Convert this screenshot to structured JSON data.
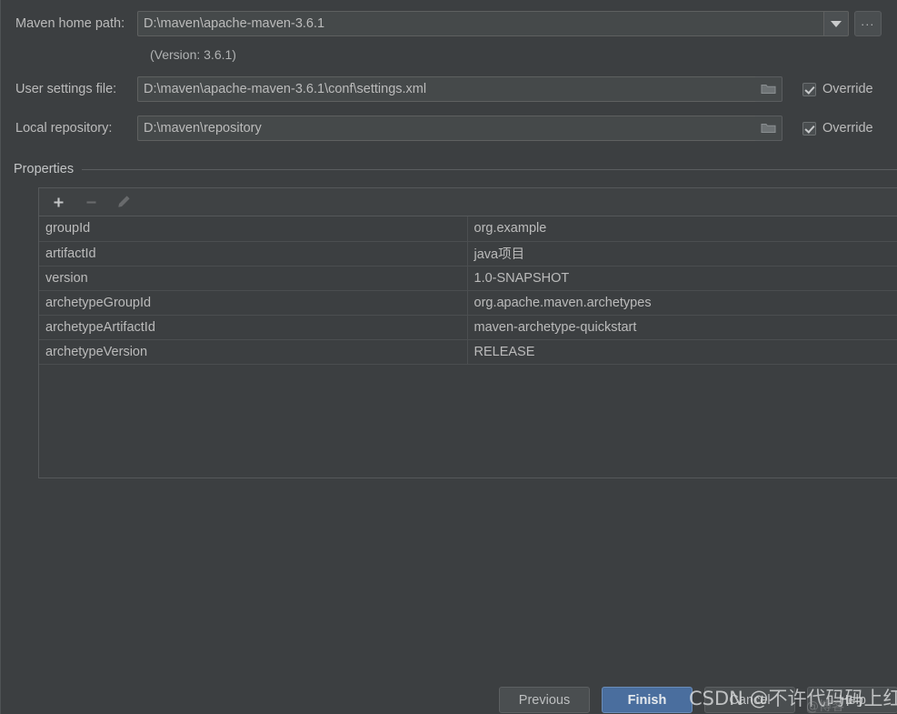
{
  "colors": {
    "background": "#3c3f41",
    "field_bg": "#45494a",
    "text": "#bbbbbb",
    "accent_primary": "#4a6e9e",
    "border": "#5a5d5f"
  },
  "form": {
    "maven_home": {
      "label": "Maven home path:",
      "value": "D:\\maven\\apache-maven-3.6.1",
      "version_note": "(Version: 3.6.1)"
    },
    "user_settings": {
      "label": "User settings file:",
      "value": "D:\\maven\\apache-maven-3.6.1\\conf\\settings.xml",
      "override_label": "Override"
    },
    "local_repository": {
      "label": "Local repository:",
      "value": "D:\\maven\\repository",
      "override_label": "Override"
    },
    "ellipsis_button_label": "..."
  },
  "properties": {
    "group_title": "Properties",
    "toolbar": {
      "add_label": "+",
      "remove_label": "−",
      "edit_label": "edit"
    },
    "rows": [
      {
        "key": "groupId",
        "value": "org.example"
      },
      {
        "key": "artifactId",
        "value": "java项目"
      },
      {
        "key": "version",
        "value": "1.0-SNAPSHOT"
      },
      {
        "key": "archetypeGroupId",
        "value": "org.apache.maven.archetypes"
      },
      {
        "key": "archetypeArtifactId",
        "value": "maven-archetype-quickstart"
      },
      {
        "key": "archetypeVersion",
        "value": "RELEASE"
      }
    ]
  },
  "buttons": {
    "previous": "Previous",
    "finish": "Finish",
    "cancel": "Cancel",
    "help": "Help"
  },
  "watermark": {
    "primary": "CSDN @不许代码码上红",
    "secondary": "@博客"
  }
}
